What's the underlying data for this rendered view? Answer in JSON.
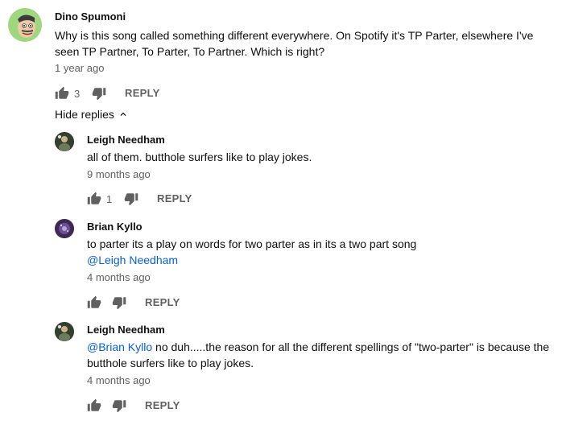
{
  "comment": {
    "author": "Dino Spumoni",
    "text": "Why is this song called something different everywhere. On Spotify it's TP Parter, elsewhere I've seen TP Partner, To Parter, To Partner. Which is right?",
    "time": "1 year ago",
    "likes": "3",
    "reply_label": "REPLY"
  },
  "hide_replies_label": "Hide replies",
  "replies": [
    {
      "author": "Leigh Needham",
      "text": "all of them.  butthole surfers like to play jokes.",
      "time": "9 months ago",
      "likes": "1",
      "reply_label": "REPLY"
    },
    {
      "author": "Brian Kyllo",
      "text": "to parter its a play on words for two parter as in its a two part song",
      "mention": "@Leigh Needham",
      "time": "4 months ago",
      "reply_label": "REPLY"
    },
    {
      "author": "Leigh Needham",
      "mention": "@Brian Kyllo",
      "text": " no duh.....the reason for all the different spellings of \"two-parter\" is because the butthole surfers like to play jokes.",
      "time": "4 months ago",
      "reply_label": "REPLY"
    }
  ],
  "colors": {
    "link": "#065fd4",
    "secondary": "#606060",
    "primary": "#0f0f0f"
  }
}
